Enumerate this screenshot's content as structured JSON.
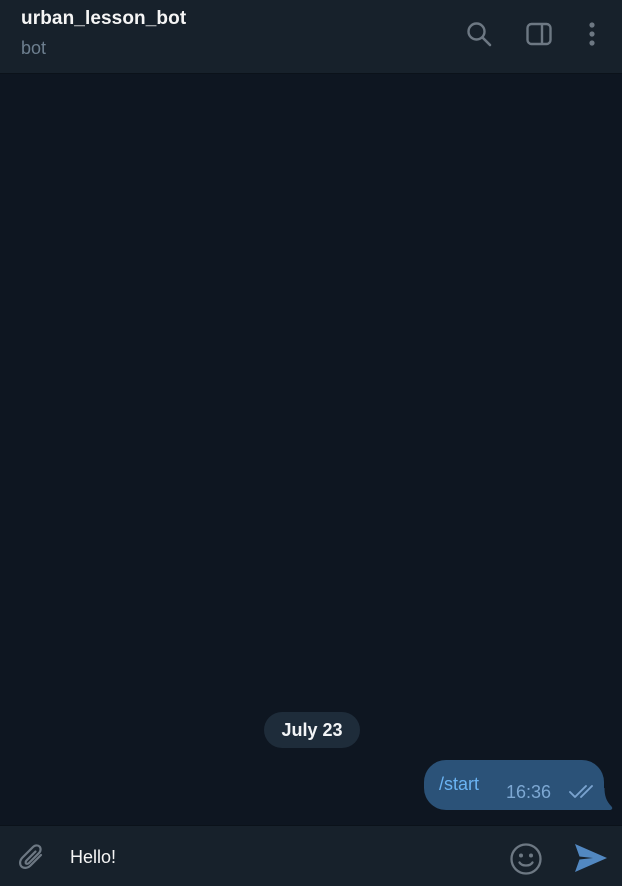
{
  "header": {
    "title": "urban_lesson_bot",
    "subtitle": "bot",
    "icons": [
      "search-icon",
      "sidebar-toggle-icon",
      "more-vertical-icon"
    ]
  },
  "messages": {
    "date_separator": "July 23",
    "items": [
      {
        "direction": "outgoing",
        "text": "/start",
        "time": "16:36",
        "status_icon": "double-check-icon"
      }
    ]
  },
  "composer": {
    "value": "Hello!",
    "icons": [
      "paperclip-icon",
      "emoji-icon",
      "send-icon"
    ]
  },
  "colors": {
    "window_bg": "#0e1621",
    "panel_bg": "#17212b",
    "outgoing_bubble": "#2b5278",
    "command_link": "#6ab3f3",
    "date_pill": "#1e2c3a",
    "icon_gray": "#6d7883",
    "send_blue": "#5288c1"
  }
}
